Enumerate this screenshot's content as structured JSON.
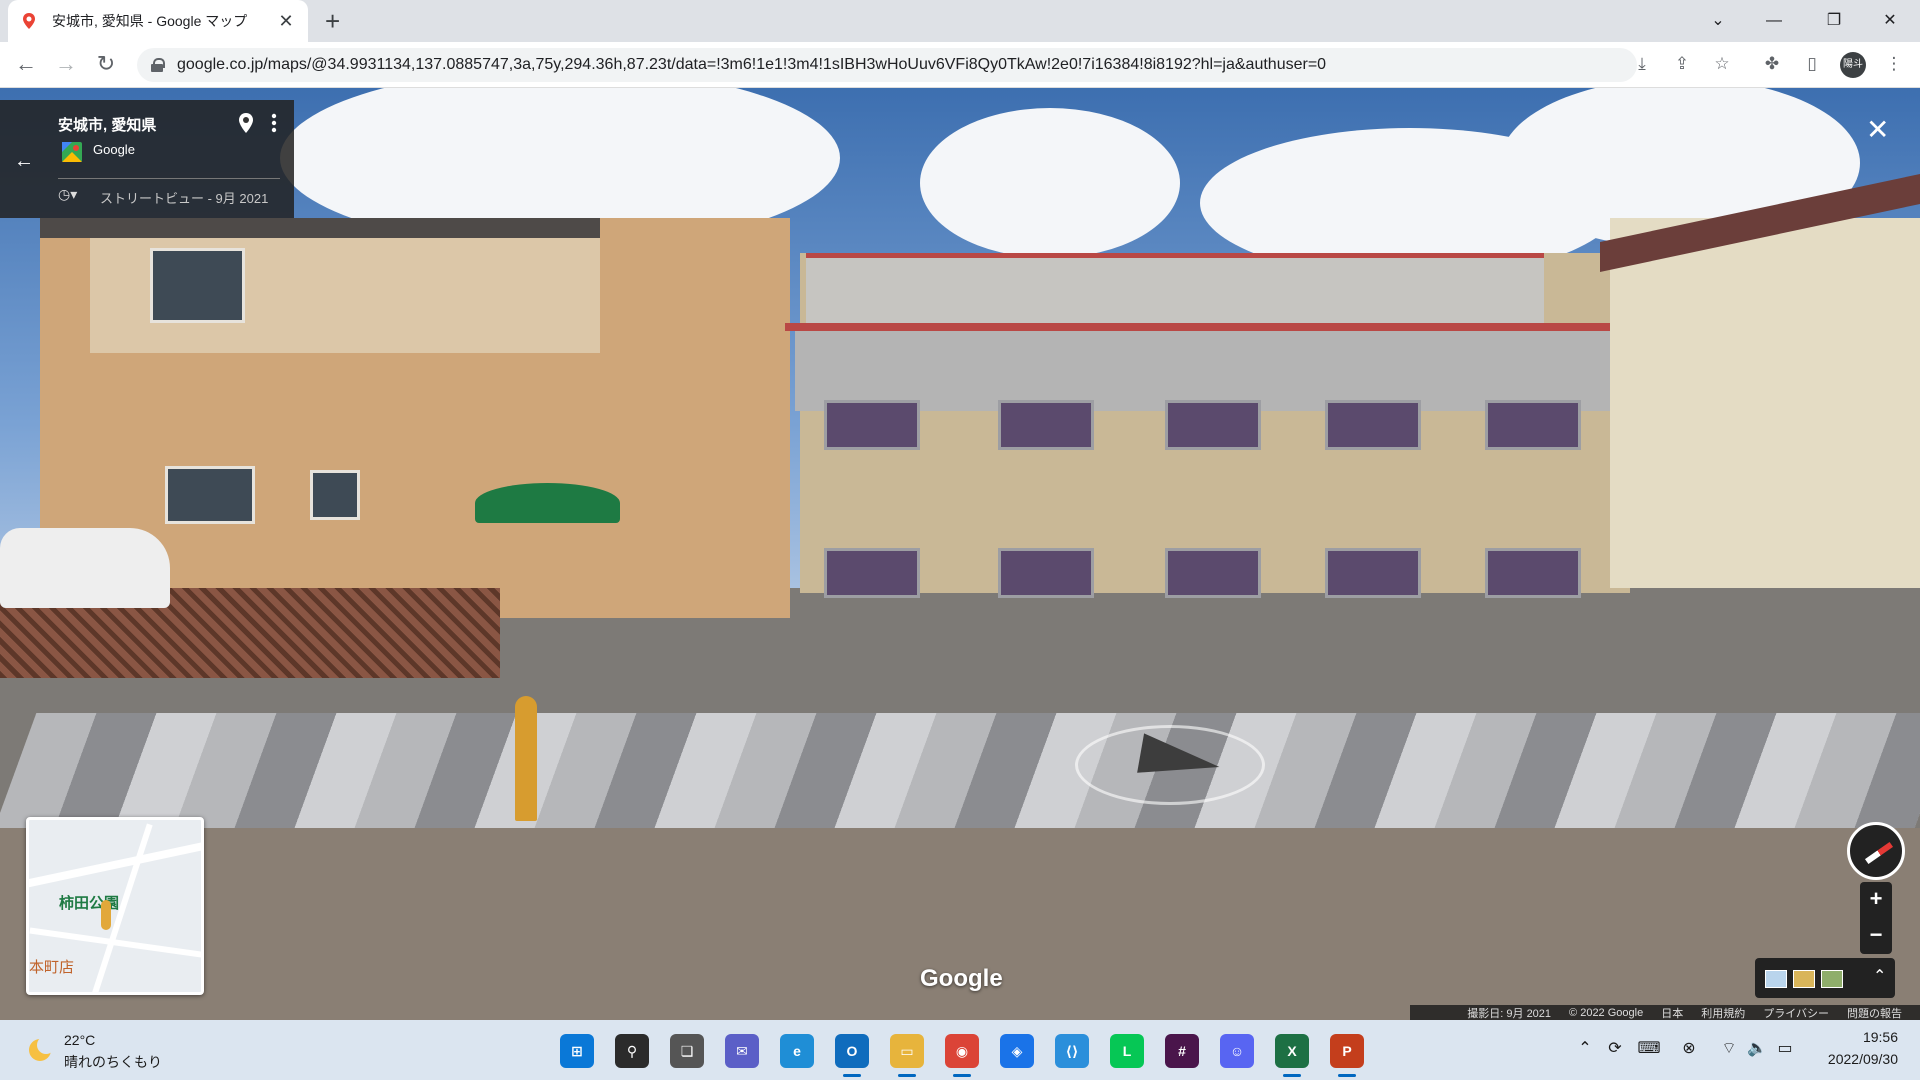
{
  "browser": {
    "tab_title": "安城市, 愛知県 - Google マップ",
    "new_tab": "+",
    "tab_close": "✕",
    "url": "google.co.jp/maps/@34.9931134,137.0885747,3a,75y,294.36h,87.23t/data=!3m6!1e1!3m4!1sIBH3wHoUuv6VFi8Qy0TkAw!2e0!7i16384!8i8192?hl=ja&authuser=0",
    "profile_label": "陽斗",
    "window_controls": [
      "⌄",
      "—",
      "❐",
      "✕"
    ]
  },
  "streetview": {
    "place_title": "安城市, 愛知県",
    "provider": "Google",
    "history_label": "ストリートビュー - 9月 2021",
    "watermark": "Google",
    "back_arrow": "←",
    "close": "✕",
    "zoom_in": "+",
    "zoom_out": "−",
    "layers_expand": "⌃",
    "minimap": {
      "park_label": "柿田公園",
      "town_label": "本町店"
    },
    "footer": {
      "capture_date": "撮影日: 9月 2021",
      "copyright": "© 2022 Google",
      "country": "日本",
      "terms": "利用規約",
      "privacy": "プライバシー",
      "report": "問題の報告"
    }
  },
  "taskbar": {
    "weather_temp": "22°C",
    "weather_condition": "晴れのちくもり",
    "apps": [
      {
        "name": "start",
        "label": "⊞",
        "color": "#0a78d7"
      },
      {
        "name": "search",
        "label": "⚲",
        "color": "#2b2b2b"
      },
      {
        "name": "task-view",
        "label": "❏",
        "color": "#555555"
      },
      {
        "name": "teams",
        "label": "✉",
        "color": "#5b5fc7"
      },
      {
        "name": "edge",
        "label": "e",
        "color": "#1f8ed6"
      },
      {
        "name": "outlook",
        "label": "O",
        "color": "#0f6cbd"
      },
      {
        "name": "explorer",
        "label": "▭",
        "color": "#e7b43c"
      },
      {
        "name": "chrome",
        "label": "◉",
        "color": "#db4437"
      },
      {
        "name": "maps",
        "label": "◈",
        "color": "#1a73e8"
      },
      {
        "name": "vscode",
        "label": "⟨⟩",
        "color": "#2b8fdb"
      },
      {
        "name": "line",
        "label": "L",
        "color": "#06c755"
      },
      {
        "name": "slack",
        "label": "#",
        "color": "#4a154b"
      },
      {
        "name": "discord",
        "label": "☺",
        "color": "#5865f2"
      },
      {
        "name": "excel",
        "label": "X",
        "color": "#1d7044"
      },
      {
        "name": "powerpoint",
        "label": "P",
        "color": "#c43e1c"
      }
    ],
    "tray": [
      "⌃",
      "⟳",
      "⌨",
      "⊗",
      "⌔",
      "🔈",
      "▭"
    ],
    "time": "19:56",
    "date": "2022/09/30"
  },
  "colors": {
    "accent": "#1a73e8",
    "chrome_bg": "#dee1e6",
    "taskbar_bg": "#dbe5f0",
    "roof_red": "#b94845"
  }
}
